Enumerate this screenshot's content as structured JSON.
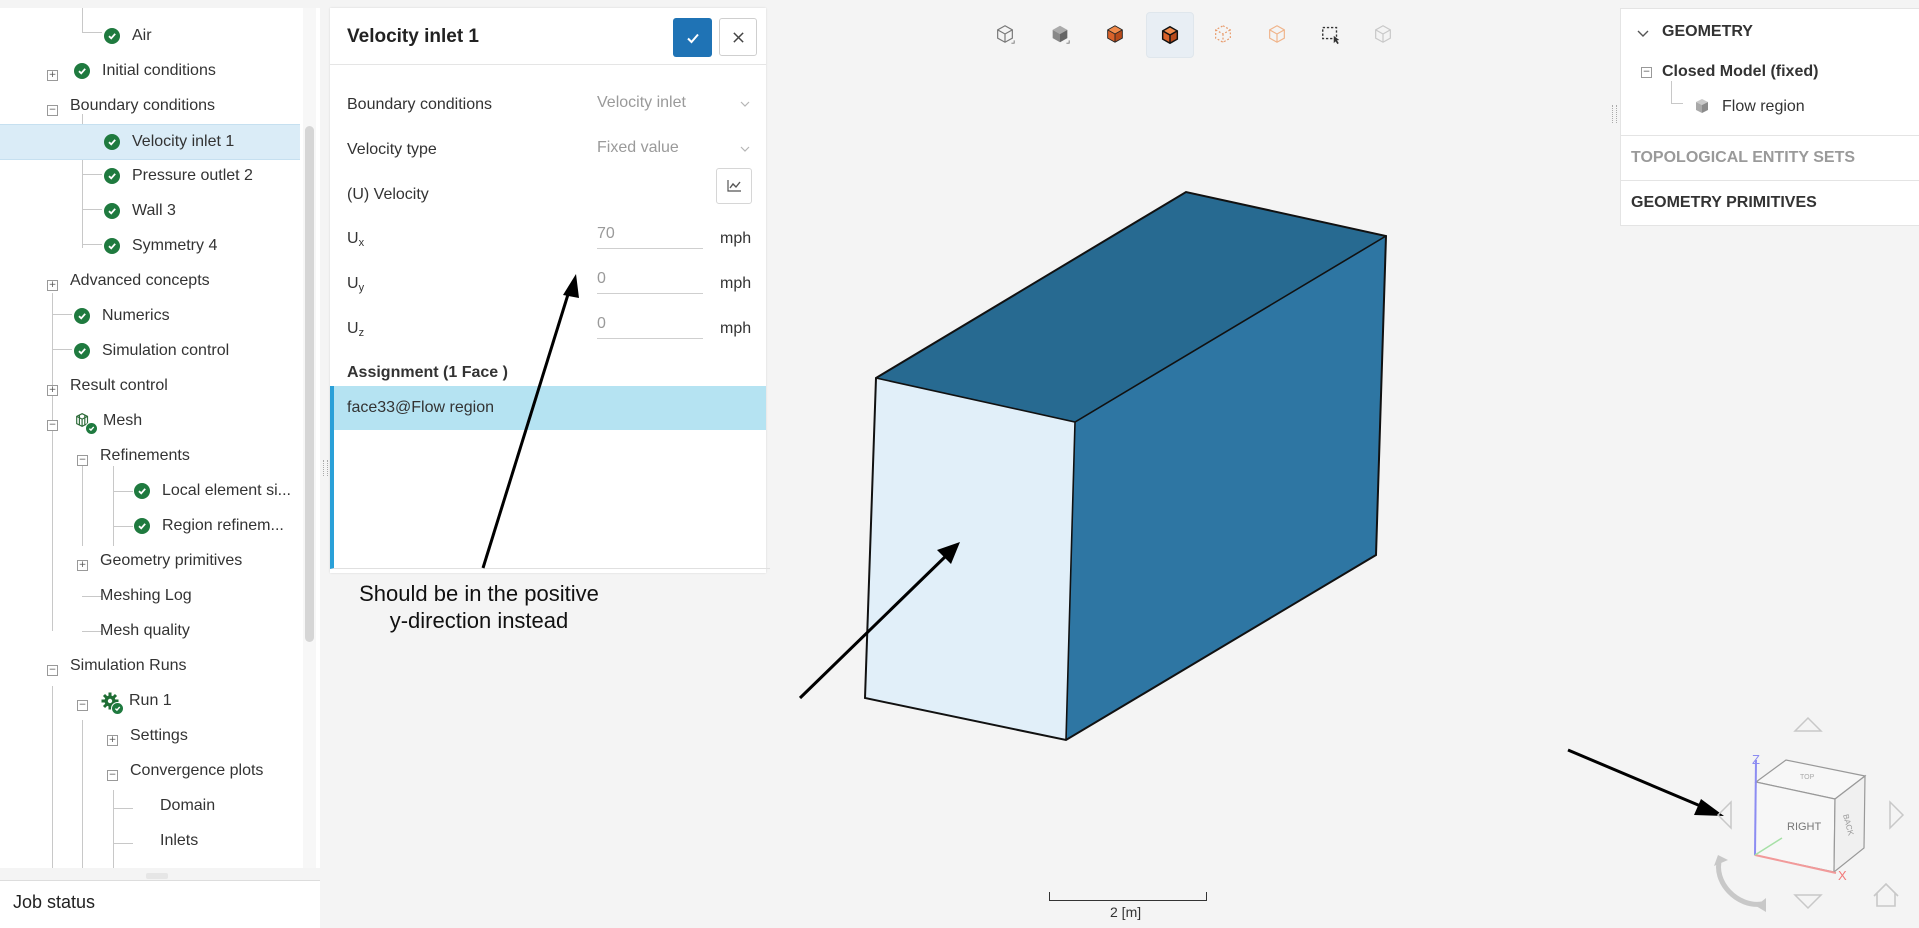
{
  "tree": {
    "items": [
      {
        "label": "Air"
      },
      {
        "label": "Initial conditions"
      },
      {
        "label": "Boundary conditions"
      },
      {
        "label": "Velocity inlet 1"
      },
      {
        "label": "Pressure outlet 2"
      },
      {
        "label": "Wall 3"
      },
      {
        "label": "Symmetry 4"
      },
      {
        "label": "Advanced concepts"
      },
      {
        "label": "Numerics"
      },
      {
        "label": "Simulation control"
      },
      {
        "label": "Result control"
      },
      {
        "label": "Mesh"
      },
      {
        "label": "Refinements"
      },
      {
        "label": "Local element si..."
      },
      {
        "label": "Region refinem..."
      },
      {
        "label": "Geometry primitives"
      },
      {
        "label": "Meshing Log"
      },
      {
        "label": "Mesh quality"
      },
      {
        "label": "Simulation Runs"
      },
      {
        "label": "Run 1"
      },
      {
        "label": "Settings"
      },
      {
        "label": "Convergence plots"
      },
      {
        "label": "Domain"
      },
      {
        "label": "Inlets"
      }
    ]
  },
  "job_status": {
    "label": "Job status"
  },
  "dialog": {
    "title": "Velocity inlet 1",
    "fields": {
      "boundary_conditions": {
        "label": "Boundary conditions",
        "value": "Velocity inlet"
      },
      "velocity_type": {
        "label": "Velocity type",
        "value": "Fixed value"
      },
      "velocity": {
        "label": "(U) Velocity"
      }
    },
    "components": [
      {
        "base": "U",
        "sub": "x",
        "value": "70",
        "unit": "mph"
      },
      {
        "base": "U",
        "sub": "y",
        "value": "0",
        "unit": "mph"
      },
      {
        "base": "U",
        "sub": "z",
        "value": "0",
        "unit": "mph"
      }
    ],
    "assignment": {
      "title": "Assignment (1 Face )",
      "items": [
        "face33@Flow region"
      ]
    }
  },
  "geometry_panel": {
    "header": "GEOMETRY",
    "model": "Closed Model (fixed)",
    "region": "Flow region",
    "topological_sets": "TOPOLOGICAL ENTITY SETS",
    "primitives": "GEOMETRY PRIMITIVES"
  },
  "annotation": {
    "line1": "Should be in the positive",
    "line2": "y-direction instead"
  },
  "viewcube": {
    "right_label": "RIGHT",
    "back_label": "BACK",
    "top_label": "TOP",
    "axis_z": "Z",
    "axis_x": "X"
  },
  "scale": {
    "label": "2 [m]"
  },
  "colors": {
    "accent": "#1f73b5",
    "check_green": "#1f7a3f",
    "selection": "#daecf7",
    "assignment_highlight": "#b5e3f2",
    "box_top": "#276a91",
    "box_side": "#2e76a3",
    "box_front": "#e1eff9"
  }
}
